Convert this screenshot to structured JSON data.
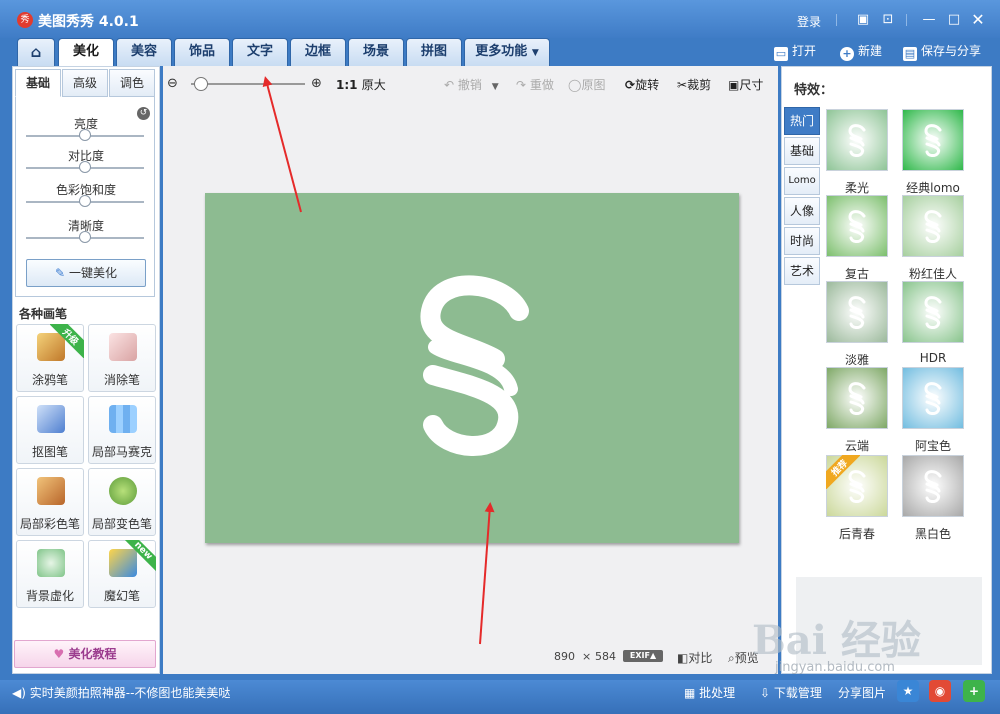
{
  "app": {
    "logo_char": "秀",
    "title": "美图秀秀 4.0.1"
  },
  "titlebar": {
    "login": "登录",
    "icons": [
      "chat-icon",
      "skin-icon",
      "minimize-icon",
      "maximize-icon",
      "close-icon"
    ]
  },
  "tabs": [
    "美化",
    "美容",
    "饰品",
    "文字",
    "边框",
    "场景",
    "拼图",
    "更多功能"
  ],
  "file_tools": {
    "open": "打开",
    "new": "新建",
    "save": "保存与分享"
  },
  "left_panel": {
    "subtabs": [
      "基础",
      "高级",
      "调色"
    ],
    "sliders": [
      {
        "label": "亮度",
        "value": 0.5
      },
      {
        "label": "对比度",
        "value": 0.5
      },
      {
        "label": "色彩饱和度",
        "value": 0.5
      },
      {
        "label": "清晰度",
        "value": 0.5
      }
    ],
    "one_key": "一键美化",
    "brush_title": "各种画笔",
    "brushes": [
      {
        "label": "涂鸦笔",
        "badge": "升级",
        "color": "#e0a640"
      },
      {
        "label": "消除笔",
        "badge": "",
        "color": "#f2c7c7"
      },
      {
        "label": "抠图笔",
        "badge": "",
        "color": "#5d8ed6"
      },
      {
        "label": "局部马赛克",
        "badge": "",
        "color": "#5fa0e8"
      },
      {
        "label": "局部彩色笔",
        "badge": "",
        "color": "#d98c3c"
      },
      {
        "label": "局部变色笔",
        "badge": "",
        "color": "#79b84a"
      },
      {
        "label": "背景虚化",
        "badge": "",
        "color": "#6fbf78"
      },
      {
        "label": "魔幻笔",
        "badge": "new",
        "color": "#3d8de0"
      }
    ],
    "tutorial": "美化教程"
  },
  "canvas_toolbar": {
    "ratio": "1:1",
    "original": "原大",
    "undo": "撤销",
    "redo": "重做",
    "origin": "原图",
    "rotate": "旋转",
    "crop": "裁剪",
    "size": "尺寸"
  },
  "zoom_level": 0.05,
  "image": {
    "width": "890",
    "times": "×",
    "height": "584",
    "exif": "EXIF▲",
    "compare": "对比",
    "preview": "预览"
  },
  "effects": {
    "title": "特效：",
    "categories": [
      "热门",
      "基础",
      "Lomo",
      "人像",
      "时尚",
      "艺术"
    ],
    "items": [
      {
        "label": "柔光",
        "color": "#8ec496"
      },
      {
        "label": "经典lomo",
        "color": "#2fb84a"
      },
      {
        "label": "复古",
        "color": "#7cbf6d"
      },
      {
        "label": "粉红佳人",
        "color": "#a6cf9e"
      },
      {
        "label": "淡雅",
        "color": "#9bb99b"
      },
      {
        "label": "HDR",
        "color": "#88c48c"
      },
      {
        "label": "云端",
        "color": "#7ea866"
      },
      {
        "label": "阿宝色",
        "color": "#72bde0"
      },
      {
        "label": "后青春",
        "color": "#cbd89a",
        "badge": "推荐"
      },
      {
        "label": "黑白色",
        "color": "#a8a8a8"
      }
    ]
  },
  "status": {
    "camera": "实时美颜拍照神器--不修图也能美美哒",
    "batch": "批处理",
    "download": "下载管理",
    "share": "分享图片"
  },
  "watermark": {
    "brand": "Bai 经验",
    "url": "jingyan.baidu.com"
  },
  "colors": {
    "accent": "#3f7cc6",
    "canvas": "#8dbb91"
  }
}
